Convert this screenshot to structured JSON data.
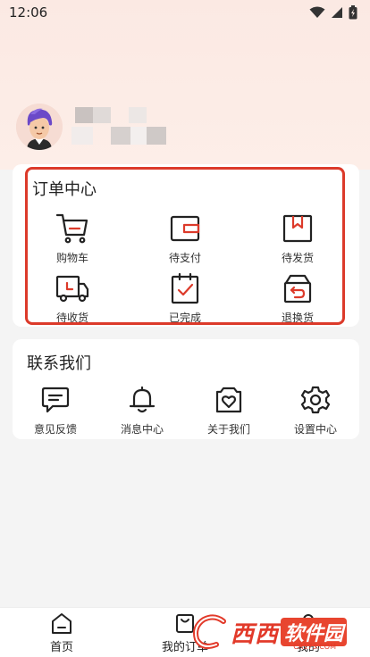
{
  "status_bar": {
    "time": "12:06"
  },
  "orders": {
    "title": "订单中心",
    "items": [
      {
        "label": "购物车",
        "icon": "cart-icon"
      },
      {
        "label": "待支付",
        "icon": "wallet-icon"
      },
      {
        "label": "待发货",
        "icon": "package-icon"
      },
      {
        "label": "待收货",
        "icon": "truck-icon"
      },
      {
        "label": "已完成",
        "icon": "clipboard-check-icon"
      },
      {
        "label": "退换货",
        "icon": "return-box-icon"
      }
    ]
  },
  "contact": {
    "title": "联系我们",
    "items": [
      {
        "label": "意见反馈",
        "icon": "feedback-icon"
      },
      {
        "label": "消息中心",
        "icon": "bell-icon"
      },
      {
        "label": "关于我们",
        "icon": "heart-badge-icon"
      },
      {
        "label": "设置中心",
        "icon": "gear-icon"
      }
    ]
  },
  "tabbar": {
    "items": [
      {
        "label": "首页",
        "icon": "home-icon"
      },
      {
        "label": "我的订单",
        "icon": "bag-icon"
      },
      {
        "label": "我的",
        "icon": "user-icon"
      }
    ]
  },
  "watermark": {
    "brand": "西西",
    "sub": "软件园",
    "url": "CR173.COM"
  },
  "colors": {
    "accent": "#dc3a2a",
    "header_bg": "#fbe9e3",
    "page_bg": "#f4f4f4"
  }
}
